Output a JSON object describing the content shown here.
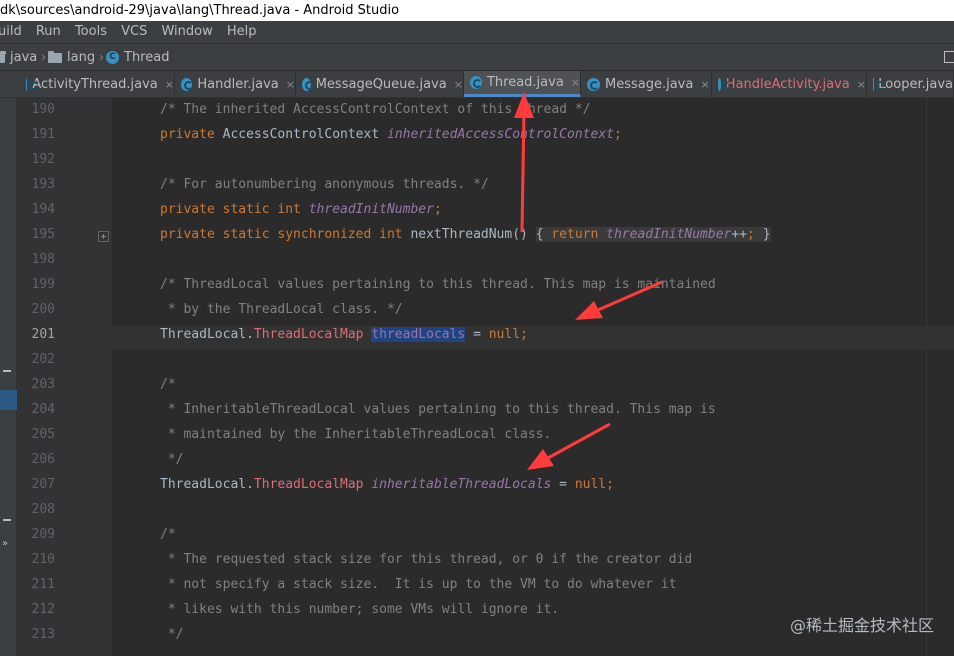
{
  "window": {
    "title": "dk\\sources\\android-29\\java\\lang\\Thread.java - Android Studio"
  },
  "menu": [
    "uild",
    "Run",
    "Tools",
    "VCS",
    "Window",
    "Help"
  ],
  "breadcrumb": {
    "items": [
      "java",
      "lang",
      "Thread"
    ]
  },
  "tabs": [
    {
      "label": "ActivityThread.java",
      "close": "×"
    },
    {
      "label": "Handler.java",
      "close": "×"
    },
    {
      "label": "MessageQueue.java",
      "close": "×"
    },
    {
      "label": "Thread.java",
      "close": "×",
      "active": true
    },
    {
      "label": "Message.java",
      "close": "×"
    },
    {
      "label": "HandleActivity.java",
      "close": "×",
      "modified": true
    },
    {
      "label": "Looper.java"
    }
  ],
  "editor": {
    "current_line": "201",
    "lines": [
      {
        "n": "190",
        "segs": [
          [
            "cm",
            "/* The inherited AccessControlContext of this thread */"
          ]
        ]
      },
      {
        "n": "191",
        "segs": [
          [
            "kw",
            "private "
          ],
          [
            "cl",
            "AccessControlContext "
          ],
          [
            "fd",
            "inheritedAccessControlContext"
          ],
          [
            "kw",
            ";"
          ]
        ]
      },
      {
        "n": "192",
        "segs": []
      },
      {
        "n": "193",
        "segs": [
          [
            "cm",
            "/* For autonumbering anonymous threads. */"
          ]
        ]
      },
      {
        "n": "194",
        "segs": [
          [
            "kw",
            "private static int "
          ],
          [
            "fd",
            "threadInitNumber"
          ],
          [
            "kw",
            ";"
          ]
        ]
      },
      {
        "n": "195",
        "segs": [
          [
            "kw",
            "private static synchronized int "
          ],
          [
            "cl",
            "nextThreadNum() "
          ],
          [
            "fold",
            "{ "
          ],
          [
            "kwf",
            "return "
          ],
          [
            "fdf",
            "threadInitNumber"
          ],
          [
            "clf",
            "++"
          ],
          [
            "kwf",
            "; "
          ],
          [
            "fold",
            "}"
          ]
        ]
      },
      {
        "n": "198",
        "segs": []
      },
      {
        "n": "199",
        "segs": [
          [
            "cm",
            "/* ThreadLocal values pertaining to this thread. This map is maintained"
          ]
        ]
      },
      {
        "n": "200",
        "segs": [
          [
            "cm",
            " * by the ThreadLocal class. */"
          ]
        ]
      },
      {
        "n": "201",
        "segs": [
          [
            "cl",
            "ThreadLocal."
          ],
          [
            "rc",
            "ThreadLocalMap "
          ],
          [
            "hl",
            "threadLocals"
          ],
          [
            "cl",
            " = "
          ],
          [
            "kw",
            "null;"
          ]
        ]
      },
      {
        "n": "202",
        "segs": []
      },
      {
        "n": "203",
        "segs": [
          [
            "cm",
            "/*"
          ]
        ]
      },
      {
        "n": "204",
        "segs": [
          [
            "cm",
            " * InheritableThreadLocal values pertaining to this thread. This map is"
          ]
        ]
      },
      {
        "n": "205",
        "segs": [
          [
            "cm",
            " * maintained by the InheritableThreadLocal class."
          ]
        ]
      },
      {
        "n": "206",
        "segs": [
          [
            "cm",
            " */"
          ]
        ]
      },
      {
        "n": "207",
        "segs": [
          [
            "cl",
            "ThreadLocal."
          ],
          [
            "rc",
            "ThreadLocalMap "
          ],
          [
            "fd2",
            "inheritableThreadLocals"
          ],
          [
            "cl",
            " = "
          ],
          [
            "kw",
            "null;"
          ]
        ]
      },
      {
        "n": "208",
        "segs": []
      },
      {
        "n": "209",
        "segs": [
          [
            "cm",
            "/*"
          ]
        ]
      },
      {
        "n": "210",
        "segs": [
          [
            "cm",
            " * The requested stack size for this thread, or 0 if the creator did"
          ]
        ]
      },
      {
        "n": "211",
        "segs": [
          [
            "cm",
            " * not specify a stack size.  It is up to the VM to do whatever it"
          ]
        ]
      },
      {
        "n": "212",
        "segs": [
          [
            "cm",
            " * likes with this number; some VMs will ignore it."
          ]
        ]
      },
      {
        "n": "213",
        "segs": [
          [
            "cm",
            " */"
          ]
        ]
      }
    ]
  },
  "watermark": "@稀土掘金技术社区",
  "colors": {
    "arrow": "#ff3b3b",
    "selection": "#214283",
    "active_tab_underline": "#4a88c7"
  }
}
